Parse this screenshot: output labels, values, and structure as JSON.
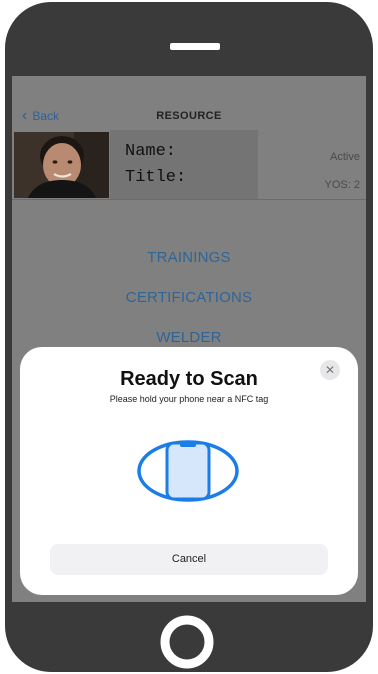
{
  "header": {
    "back_label": "Back",
    "title": "RESOURCE"
  },
  "profile": {
    "name_label": "Name:",
    "title_label": "Title:",
    "status": "Active",
    "yos": "YOS: 2"
  },
  "menu": {
    "items": [
      "TRAININGS",
      "CERTIFICATIONS",
      "WELDER"
    ]
  },
  "scan_sheet": {
    "title": "Ready to Scan",
    "subtitle": "Please hold your phone near a NFC tag",
    "cancel_label": "Cancel",
    "close_icon": "close-icon",
    "accent": "#1a7ee6"
  },
  "device": {
    "frame_color": "#3a3a3a"
  }
}
